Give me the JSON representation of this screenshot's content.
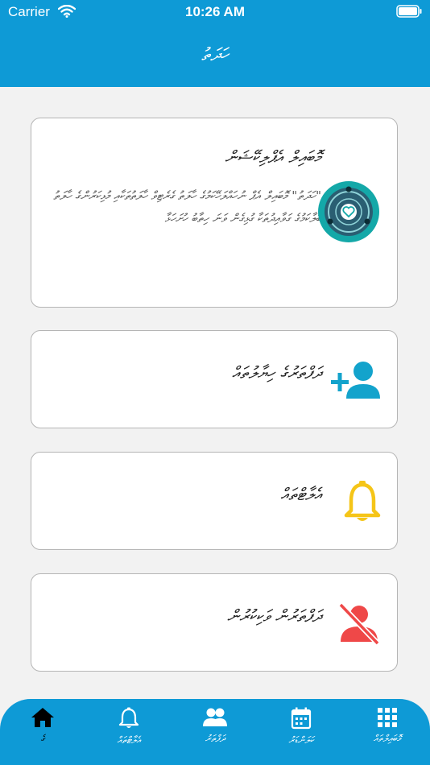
{
  "status": {
    "carrier": "Carrier",
    "time": "10:26 AM"
  },
  "nav": {
    "title": "ހަދަތު"
  },
  "cards": [
    {
      "title": "މޮބައިލް އެޕްލިކޭޝަން",
      "desc": "\"ހަދަތު\" މޮބައިލް އެޕް ނުހައްލަހޭކަމުގެ ހާލަތު ގެރެޓިވް ހާލަތުތަކާއި މުޅިކަރުންގެ ހާލަތު ބަލާކަމުގެ ގަވާއިދުތަކާ ގުޅިގެން ވަނަ ހިތާބު ހުށަހަޅާ",
      "icon": "app-logo-icon"
    },
    {
      "title": "ދަފްތަރުގެ ހިޔާލުތައް",
      "icon": "add-person-icon"
    },
    {
      "title": "އެލާޓްތައް",
      "icon": "bell-icon"
    },
    {
      "title": "ދަފްތަރުން ވަކިކުރުން",
      "icon": "person-off-icon"
    }
  ],
  "tabs": [
    {
      "label": "ގެ",
      "icon": "home-icon",
      "active": true
    },
    {
      "label": "އެލާޓްތައް",
      "icon": "bell-outline-icon",
      "active": false
    },
    {
      "label": "ދަފްތަރު",
      "icon": "people-icon",
      "active": false
    },
    {
      "label": "ކަލަންޑަރު",
      "icon": "calendar-icon",
      "active": false
    },
    {
      "label": "މޮބައިލްތައް",
      "icon": "grid-icon",
      "active": false
    }
  ],
  "colors": {
    "primary": "#0e9ad6",
    "teal": "#14a8a8",
    "bell": "#f5c518",
    "danger": "#ef4848"
  }
}
